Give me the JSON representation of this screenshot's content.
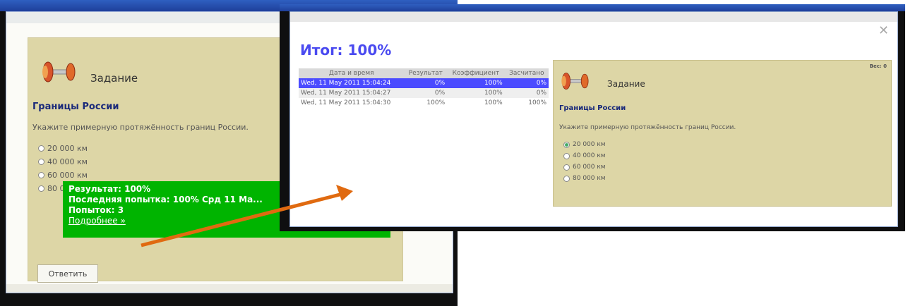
{
  "left_window": {
    "task_label": "Задание",
    "question_title": "Границы России",
    "question_text": "Укажите примерную протяжённость границ России.",
    "options": [
      "20 000 км",
      "40 000 км",
      "60 000 км",
      "80 000 км"
    ],
    "feedback": {
      "result": "Результат: 100%",
      "last_attempt": "Последняя попытка: 100% Срд 11 Ма...",
      "attempts": "Попыток: 3",
      "details_link": "Подробнее »"
    },
    "answer_button": "Ответить"
  },
  "right_window": {
    "close_glyph": "✕",
    "total": "Итог: 100%",
    "table": {
      "headers": [
        "Дата и время",
        "Результат",
        "Коэффициент",
        "Засчитано"
      ],
      "rows": [
        [
          "Wed, 11 May 2011 15:04:24",
          "0%",
          "100%",
          "0%"
        ],
        [
          "Wed, 11 May 2011 15:04:27",
          "0%",
          "100%",
          "0%"
        ],
        [
          "Wed, 11 May 2011 15:04:30",
          "100%",
          "100%",
          "100%"
        ]
      ]
    },
    "question": {
      "score_label": "Вес: 0",
      "task_label": "Задание",
      "question_title": "Границы России",
      "question_text": "Укажите примерную протяжённость границ России.",
      "options": [
        "20 000 км",
        "40 000 км",
        "60 000 км",
        "80 000 км"
      ],
      "selected_index": 0
    }
  },
  "colors": {
    "panel_bg": "#ddd6a6",
    "feedback_bg": "#00b400",
    "title_blue": "#4a4af0",
    "selected_row": "#4b4bff",
    "arrow": "#e06a10"
  },
  "icons": [
    "dumbbell-task-icon",
    "close-icon",
    "radio-icon"
  ]
}
